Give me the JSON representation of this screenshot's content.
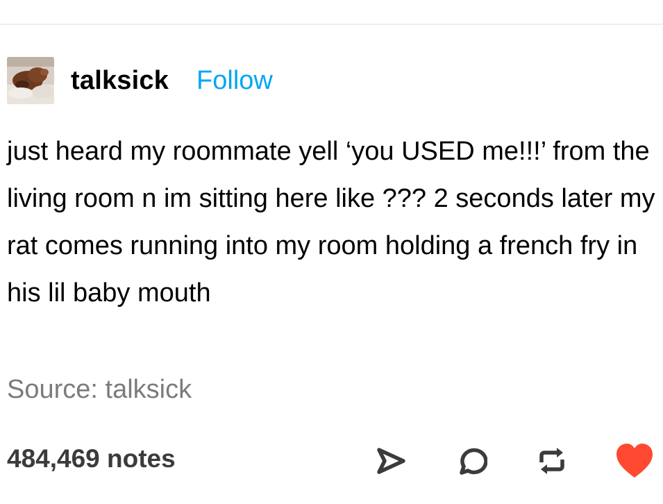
{
  "post": {
    "username": "talksick",
    "follow_label": "Follow",
    "body": "just heard my roommate yell ‘you USED me!!!’ from the living room n im sitting here like ??? 2 seconds later my rat comes running into my room holding a french fry in his lil baby mouth",
    "source_label": "Source:",
    "source_name": "talksick"
  },
  "footer": {
    "notes": "484,469 notes",
    "icons": [
      "share-icon",
      "reply-icon",
      "reblog-icon",
      "like-heart-icon"
    ],
    "like_color": "#ff4930"
  },
  "colors": {
    "follow": "#00a6f5",
    "source_text": "#7b7b7b",
    "icon_stroke": "#3b3b3b"
  }
}
